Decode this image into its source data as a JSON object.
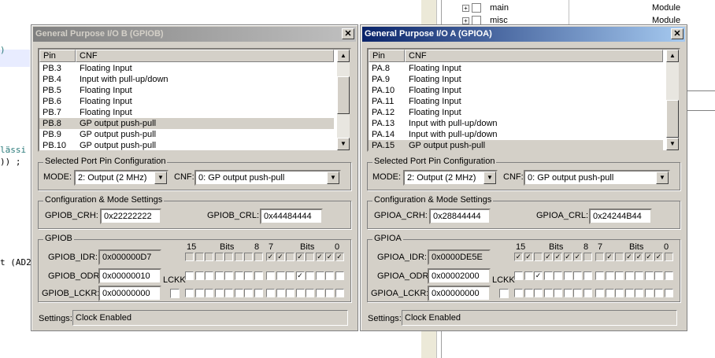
{
  "background": {
    "code_lines": [
      ")",
      "lässi",
      ")) ;",
      "t (AD2"
    ],
    "tree_items": [
      "main",
      "misc"
    ],
    "tree_types": [
      "Module",
      "Module"
    ]
  },
  "dialogs": [
    {
      "title": "General Purpose I/O B (GPIOB)",
      "active": false,
      "list": {
        "col_pin": "Pin",
        "col_cnf": "CNF",
        "rows": [
          {
            "pin": "PB.3",
            "cnf": "Floating Input",
            "selected": false
          },
          {
            "pin": "PB.4",
            "cnf": "Input with pull-up/down",
            "selected": false
          },
          {
            "pin": "PB.5",
            "cnf": "Floating Input",
            "selected": false
          },
          {
            "pin": "PB.6",
            "cnf": "Floating Input",
            "selected": false
          },
          {
            "pin": "PB.7",
            "cnf": "Floating Input",
            "selected": false
          },
          {
            "pin": "PB.8",
            "cnf": "GP output push-pull",
            "selected": true
          },
          {
            "pin": "PB.9",
            "cnf": "GP output push-pull",
            "selected": false
          },
          {
            "pin": "PB.10",
            "cnf": "GP output push-pull",
            "selected": false
          }
        ]
      },
      "selected_group_label": "Selected Port Pin Configuration",
      "mode_label": "MODE:",
      "mode_value": "2: Output (2 MHz)",
      "cnf_label": "CNF:",
      "cnf_value": "0: GP output push-pull",
      "config_group_label": "Configuration & Mode Settings",
      "crh_label": "GPIOB_CRH:",
      "crh_value": "0x22222222",
      "crl_label": "GPIOB_CRL:",
      "crl_value": "0x44484444",
      "port_group_label": "GPIOB",
      "bits_header": {
        "b15": "15",
        "bits1": "Bits",
        "b8": "8",
        "b7": "7",
        "bits2": "Bits",
        "b0": "0"
      },
      "idr_label": "GPIOB_IDR:",
      "idr_value": "0x000000D7",
      "odr_label": "GPIOB_ODR:",
      "odr_value": "0x00000010",
      "lckr_label": "GPIOB_LCKR:",
      "lckr_value": "0x00000000",
      "lckk_label": "LCKK",
      "idr_bits": [
        0,
        0,
        0,
        0,
        0,
        0,
        0,
        0,
        1,
        1,
        0,
        1,
        0,
        1,
        1,
        1
      ],
      "odr_bits": [
        0,
        0,
        0,
        0,
        0,
        0,
        0,
        0,
        0,
        0,
        0,
        1,
        0,
        0,
        0,
        0
      ],
      "lckr_bits": [
        0,
        0,
        0,
        0,
        0,
        0,
        0,
        0,
        0,
        0,
        0,
        0,
        0,
        0,
        0,
        0
      ],
      "settings_label": "Settings:",
      "settings_value": "Clock Enabled"
    },
    {
      "title": "General Purpose I/O A (GPIOA)",
      "active": true,
      "list": {
        "col_pin": "Pin",
        "col_cnf": "CNF",
        "rows": [
          {
            "pin": "PA.8",
            "cnf": "Floating Input",
            "selected": false
          },
          {
            "pin": "PA.9",
            "cnf": "Floating Input",
            "selected": false
          },
          {
            "pin": "PA.10",
            "cnf": "Floating Input",
            "selected": false
          },
          {
            "pin": "PA.11",
            "cnf": "Floating Input",
            "selected": false
          },
          {
            "pin": "PA.12",
            "cnf": "Floating Input",
            "selected": false
          },
          {
            "pin": "PA.13",
            "cnf": "Input with pull-up/down",
            "selected": false
          },
          {
            "pin": "PA.14",
            "cnf": "Input with pull-up/down",
            "selected": false
          },
          {
            "pin": "PA.15",
            "cnf": "GP output push-pull",
            "selected": true
          }
        ]
      },
      "selected_group_label": "Selected Port Pin Configuration",
      "mode_label": "MODE:",
      "mode_value": "2: Output (2 MHz)",
      "cnf_label": "CNF:",
      "cnf_value": "0: GP output push-pull",
      "config_group_label": "Configuration & Mode Settings",
      "crh_label": "GPIOA_CRH:",
      "crh_value": "0x28844444",
      "crl_label": "GPIOA_CRL:",
      "crl_value": "0x24244B44",
      "port_group_label": "GPIOA",
      "bits_header": {
        "b15": "15",
        "bits1": "Bits",
        "b8": "8",
        "b7": "7",
        "bits2": "Bits",
        "b0": "0"
      },
      "idr_label": "GPIOA_IDR:",
      "idr_value": "0x0000DE5E",
      "odr_label": "GPIOA_ODR:",
      "odr_value": "0x00002000",
      "lckr_label": "GPIOA_LCKR:",
      "lckr_value": "0x00000000",
      "lckk_label": "LCKK",
      "idr_bits": [
        1,
        1,
        0,
        1,
        1,
        1,
        1,
        0,
        0,
        1,
        0,
        1,
        1,
        1,
        1,
        0
      ],
      "odr_bits": [
        0,
        0,
        1,
        0,
        0,
        0,
        0,
        0,
        0,
        0,
        0,
        0,
        0,
        0,
        0,
        0
      ],
      "lckr_bits": [
        0,
        0,
        0,
        0,
        0,
        0,
        0,
        0,
        0,
        0,
        0,
        0,
        0,
        0,
        0,
        0
      ],
      "settings_label": "Settings:",
      "settings_value": "Clock Enabled"
    }
  ]
}
